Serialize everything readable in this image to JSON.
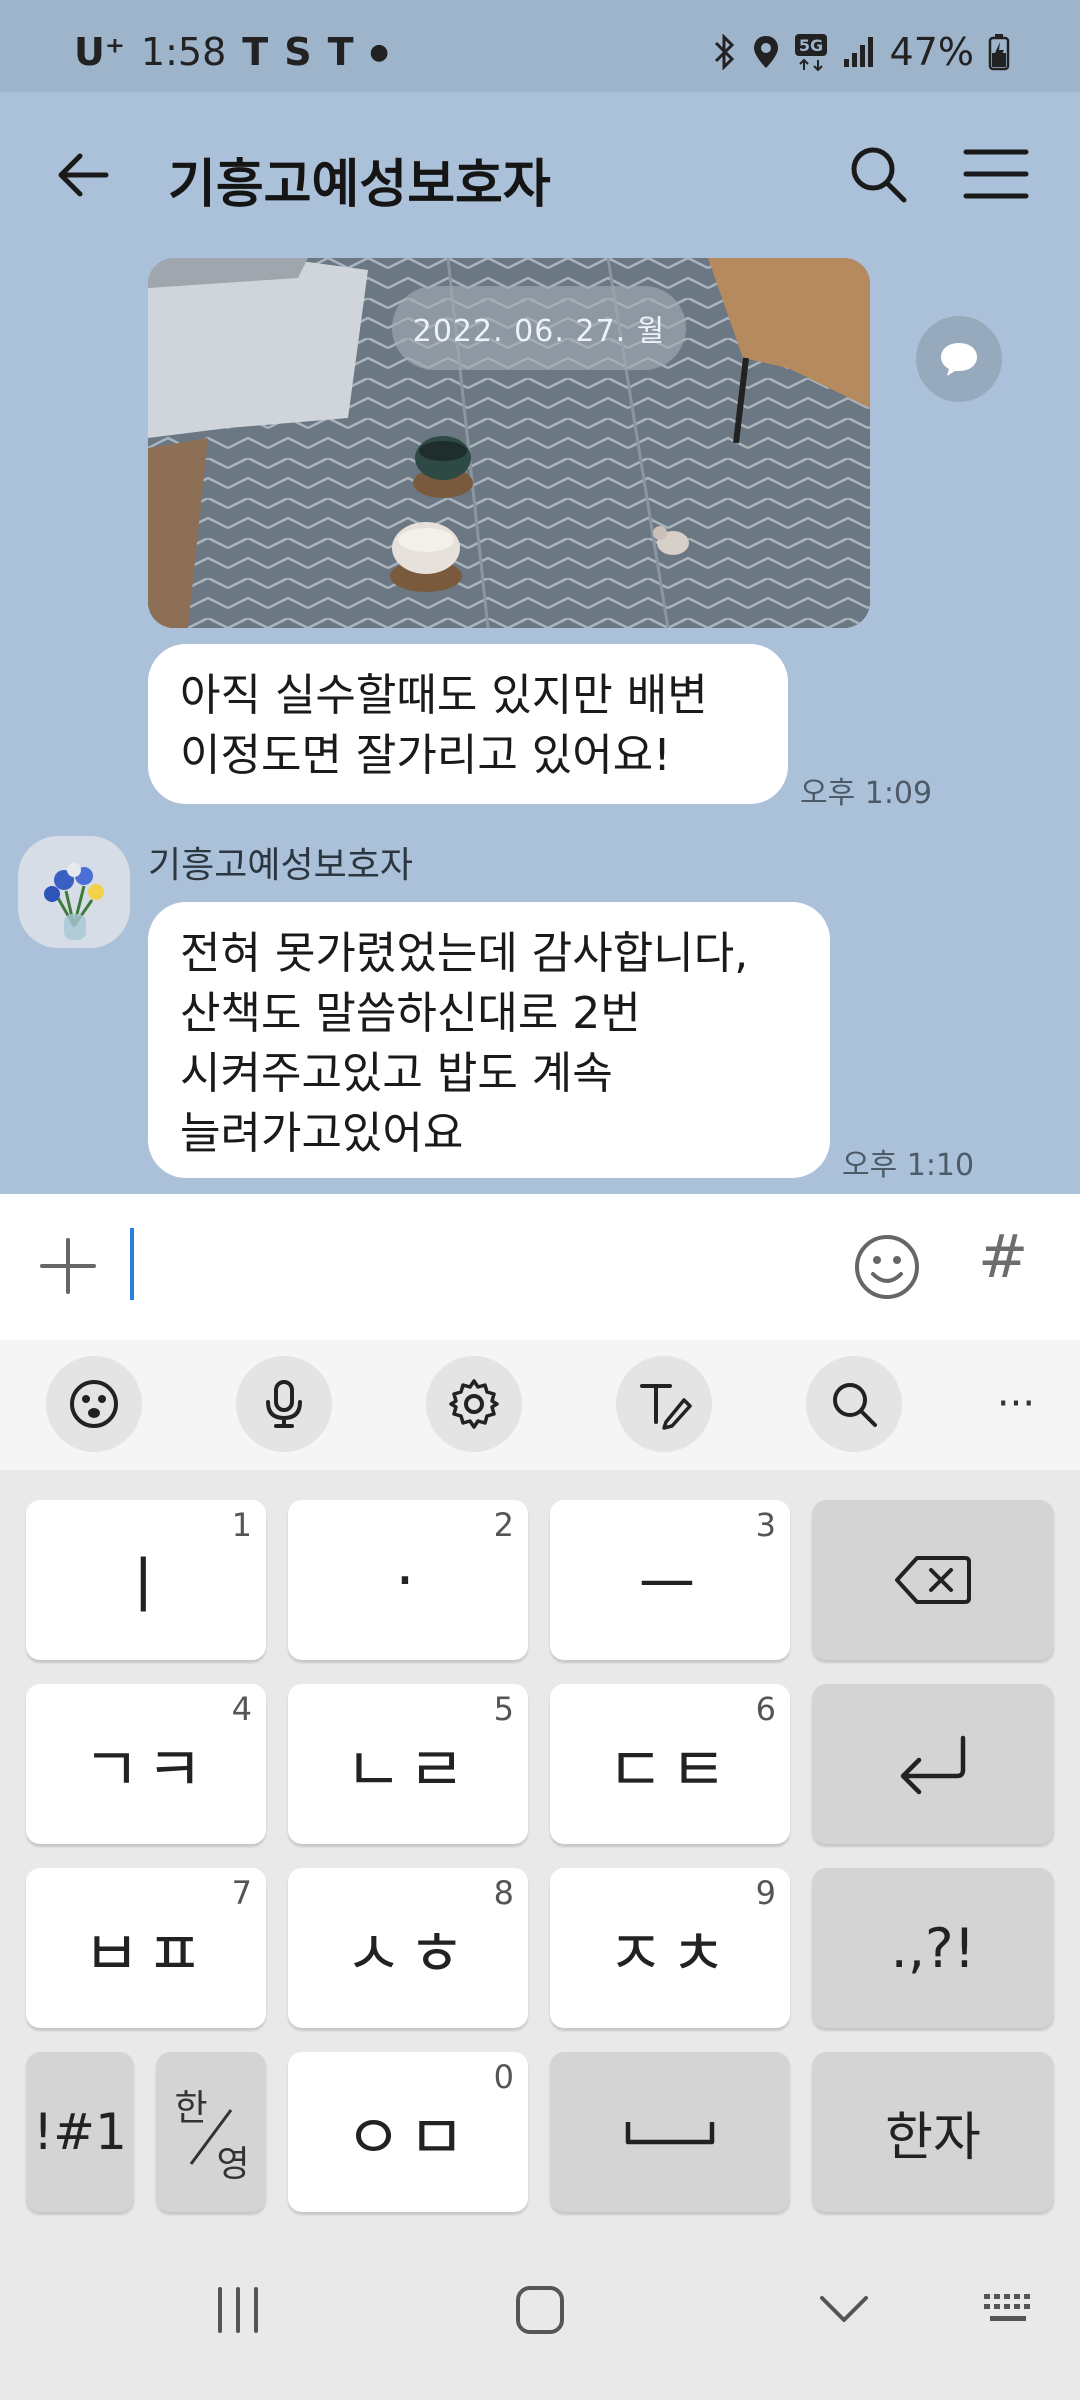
{
  "status_bar": {
    "carrier": "U⁺",
    "time": "1:58",
    "app_glyphs": [
      "T",
      "S",
      "T"
    ],
    "battery": "47%",
    "network": "5G"
  },
  "header": {
    "title": "기흥고예성보호자"
  },
  "messages": [
    {
      "type": "image",
      "date_label": "2022. 06. 27. 월"
    },
    {
      "type": "text",
      "text": "아직 실수할때도 있지만 배변\n이정도면 잘가리고 있어요!",
      "time": "오후 1:09"
    },
    {
      "type": "text",
      "sender": "기흥고예성보호자",
      "text": "전혀 못가렸었는데 감사합니다,\n산책도 말씀하신대로 2번\n시켜주고있고 밥도 계속\n늘려가고있어요",
      "time": "오후 1:10"
    }
  ],
  "input": {
    "value": "",
    "hash_label": "#"
  },
  "keyboard": {
    "toolbar": [
      "emoji-icon",
      "mic-icon",
      "settings-icon",
      "handwriting-icon",
      "search-icon",
      "more-icon"
    ],
    "more_label": "···",
    "rows": [
      [
        {
          "label": "ㅣ",
          "hint": "1"
        },
        {
          "label": "·",
          "hint": "2"
        },
        {
          "label": "ㅡ",
          "hint": "3"
        },
        {
          "label": "",
          "icon": "backspace-icon"
        }
      ],
      [
        {
          "label": "ㄱㅋ",
          "hint": "4"
        },
        {
          "label": "ㄴㄹ",
          "hint": "5"
        },
        {
          "label": "ㄷㅌ",
          "hint": "6"
        },
        {
          "label": "",
          "icon": "enter-icon"
        }
      ],
      [
        {
          "label": "ㅂㅍ",
          "hint": "7"
        },
        {
          "label": "ㅅㅎ",
          "hint": "8"
        },
        {
          "label": "ㅈㅊ",
          "hint": "9"
        },
        {
          "label": ".,?!"
        }
      ],
      [
        {
          "label": "!#1"
        },
        {
          "label": "한/영"
        },
        {
          "label": "ㅇㅁ",
          "hint": "0"
        },
        {
          "label": "",
          "icon": "space-icon"
        },
        {
          "label": "한자"
        }
      ]
    ],
    "lang_top": "한",
    "lang_bottom": "영"
  },
  "colors": {
    "chat_bg": "#abc1d9",
    "status_bg": "#9eb4cb",
    "caret": "#2a7de1"
  }
}
